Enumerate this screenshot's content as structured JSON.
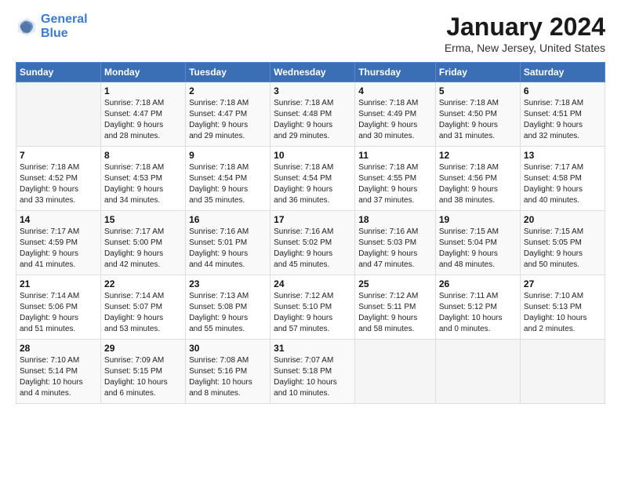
{
  "logo": {
    "line1": "General",
    "line2": "Blue"
  },
  "title": "January 2024",
  "location": "Erma, New Jersey, United States",
  "weekdays": [
    "Sunday",
    "Monday",
    "Tuesday",
    "Wednesday",
    "Thursday",
    "Friday",
    "Saturday"
  ],
  "weeks": [
    [
      {
        "num": "",
        "detail": ""
      },
      {
        "num": "1",
        "detail": "Sunrise: 7:18 AM\nSunset: 4:47 PM\nDaylight: 9 hours\nand 28 minutes."
      },
      {
        "num": "2",
        "detail": "Sunrise: 7:18 AM\nSunset: 4:47 PM\nDaylight: 9 hours\nand 29 minutes."
      },
      {
        "num": "3",
        "detail": "Sunrise: 7:18 AM\nSunset: 4:48 PM\nDaylight: 9 hours\nand 29 minutes."
      },
      {
        "num": "4",
        "detail": "Sunrise: 7:18 AM\nSunset: 4:49 PM\nDaylight: 9 hours\nand 30 minutes."
      },
      {
        "num": "5",
        "detail": "Sunrise: 7:18 AM\nSunset: 4:50 PM\nDaylight: 9 hours\nand 31 minutes."
      },
      {
        "num": "6",
        "detail": "Sunrise: 7:18 AM\nSunset: 4:51 PM\nDaylight: 9 hours\nand 32 minutes."
      }
    ],
    [
      {
        "num": "7",
        "detail": "Sunrise: 7:18 AM\nSunset: 4:52 PM\nDaylight: 9 hours\nand 33 minutes."
      },
      {
        "num": "8",
        "detail": "Sunrise: 7:18 AM\nSunset: 4:53 PM\nDaylight: 9 hours\nand 34 minutes."
      },
      {
        "num": "9",
        "detail": "Sunrise: 7:18 AM\nSunset: 4:54 PM\nDaylight: 9 hours\nand 35 minutes."
      },
      {
        "num": "10",
        "detail": "Sunrise: 7:18 AM\nSunset: 4:54 PM\nDaylight: 9 hours\nand 36 minutes."
      },
      {
        "num": "11",
        "detail": "Sunrise: 7:18 AM\nSunset: 4:55 PM\nDaylight: 9 hours\nand 37 minutes."
      },
      {
        "num": "12",
        "detail": "Sunrise: 7:18 AM\nSunset: 4:56 PM\nDaylight: 9 hours\nand 38 minutes."
      },
      {
        "num": "13",
        "detail": "Sunrise: 7:17 AM\nSunset: 4:58 PM\nDaylight: 9 hours\nand 40 minutes."
      }
    ],
    [
      {
        "num": "14",
        "detail": "Sunrise: 7:17 AM\nSunset: 4:59 PM\nDaylight: 9 hours\nand 41 minutes."
      },
      {
        "num": "15",
        "detail": "Sunrise: 7:17 AM\nSunset: 5:00 PM\nDaylight: 9 hours\nand 42 minutes."
      },
      {
        "num": "16",
        "detail": "Sunrise: 7:16 AM\nSunset: 5:01 PM\nDaylight: 9 hours\nand 44 minutes."
      },
      {
        "num": "17",
        "detail": "Sunrise: 7:16 AM\nSunset: 5:02 PM\nDaylight: 9 hours\nand 45 minutes."
      },
      {
        "num": "18",
        "detail": "Sunrise: 7:16 AM\nSunset: 5:03 PM\nDaylight: 9 hours\nand 47 minutes."
      },
      {
        "num": "19",
        "detail": "Sunrise: 7:15 AM\nSunset: 5:04 PM\nDaylight: 9 hours\nand 48 minutes."
      },
      {
        "num": "20",
        "detail": "Sunrise: 7:15 AM\nSunset: 5:05 PM\nDaylight: 9 hours\nand 50 minutes."
      }
    ],
    [
      {
        "num": "21",
        "detail": "Sunrise: 7:14 AM\nSunset: 5:06 PM\nDaylight: 9 hours\nand 51 minutes."
      },
      {
        "num": "22",
        "detail": "Sunrise: 7:14 AM\nSunset: 5:07 PM\nDaylight: 9 hours\nand 53 minutes."
      },
      {
        "num": "23",
        "detail": "Sunrise: 7:13 AM\nSunset: 5:08 PM\nDaylight: 9 hours\nand 55 minutes."
      },
      {
        "num": "24",
        "detail": "Sunrise: 7:12 AM\nSunset: 5:10 PM\nDaylight: 9 hours\nand 57 minutes."
      },
      {
        "num": "25",
        "detail": "Sunrise: 7:12 AM\nSunset: 5:11 PM\nDaylight: 9 hours\nand 58 minutes."
      },
      {
        "num": "26",
        "detail": "Sunrise: 7:11 AM\nSunset: 5:12 PM\nDaylight: 10 hours\nand 0 minutes."
      },
      {
        "num": "27",
        "detail": "Sunrise: 7:10 AM\nSunset: 5:13 PM\nDaylight: 10 hours\nand 2 minutes."
      }
    ],
    [
      {
        "num": "28",
        "detail": "Sunrise: 7:10 AM\nSunset: 5:14 PM\nDaylight: 10 hours\nand 4 minutes."
      },
      {
        "num": "29",
        "detail": "Sunrise: 7:09 AM\nSunset: 5:15 PM\nDaylight: 10 hours\nand 6 minutes."
      },
      {
        "num": "30",
        "detail": "Sunrise: 7:08 AM\nSunset: 5:16 PM\nDaylight: 10 hours\nand 8 minutes."
      },
      {
        "num": "31",
        "detail": "Sunrise: 7:07 AM\nSunset: 5:18 PM\nDaylight: 10 hours\nand 10 minutes."
      },
      {
        "num": "",
        "detail": ""
      },
      {
        "num": "",
        "detail": ""
      },
      {
        "num": "",
        "detail": ""
      }
    ]
  ]
}
